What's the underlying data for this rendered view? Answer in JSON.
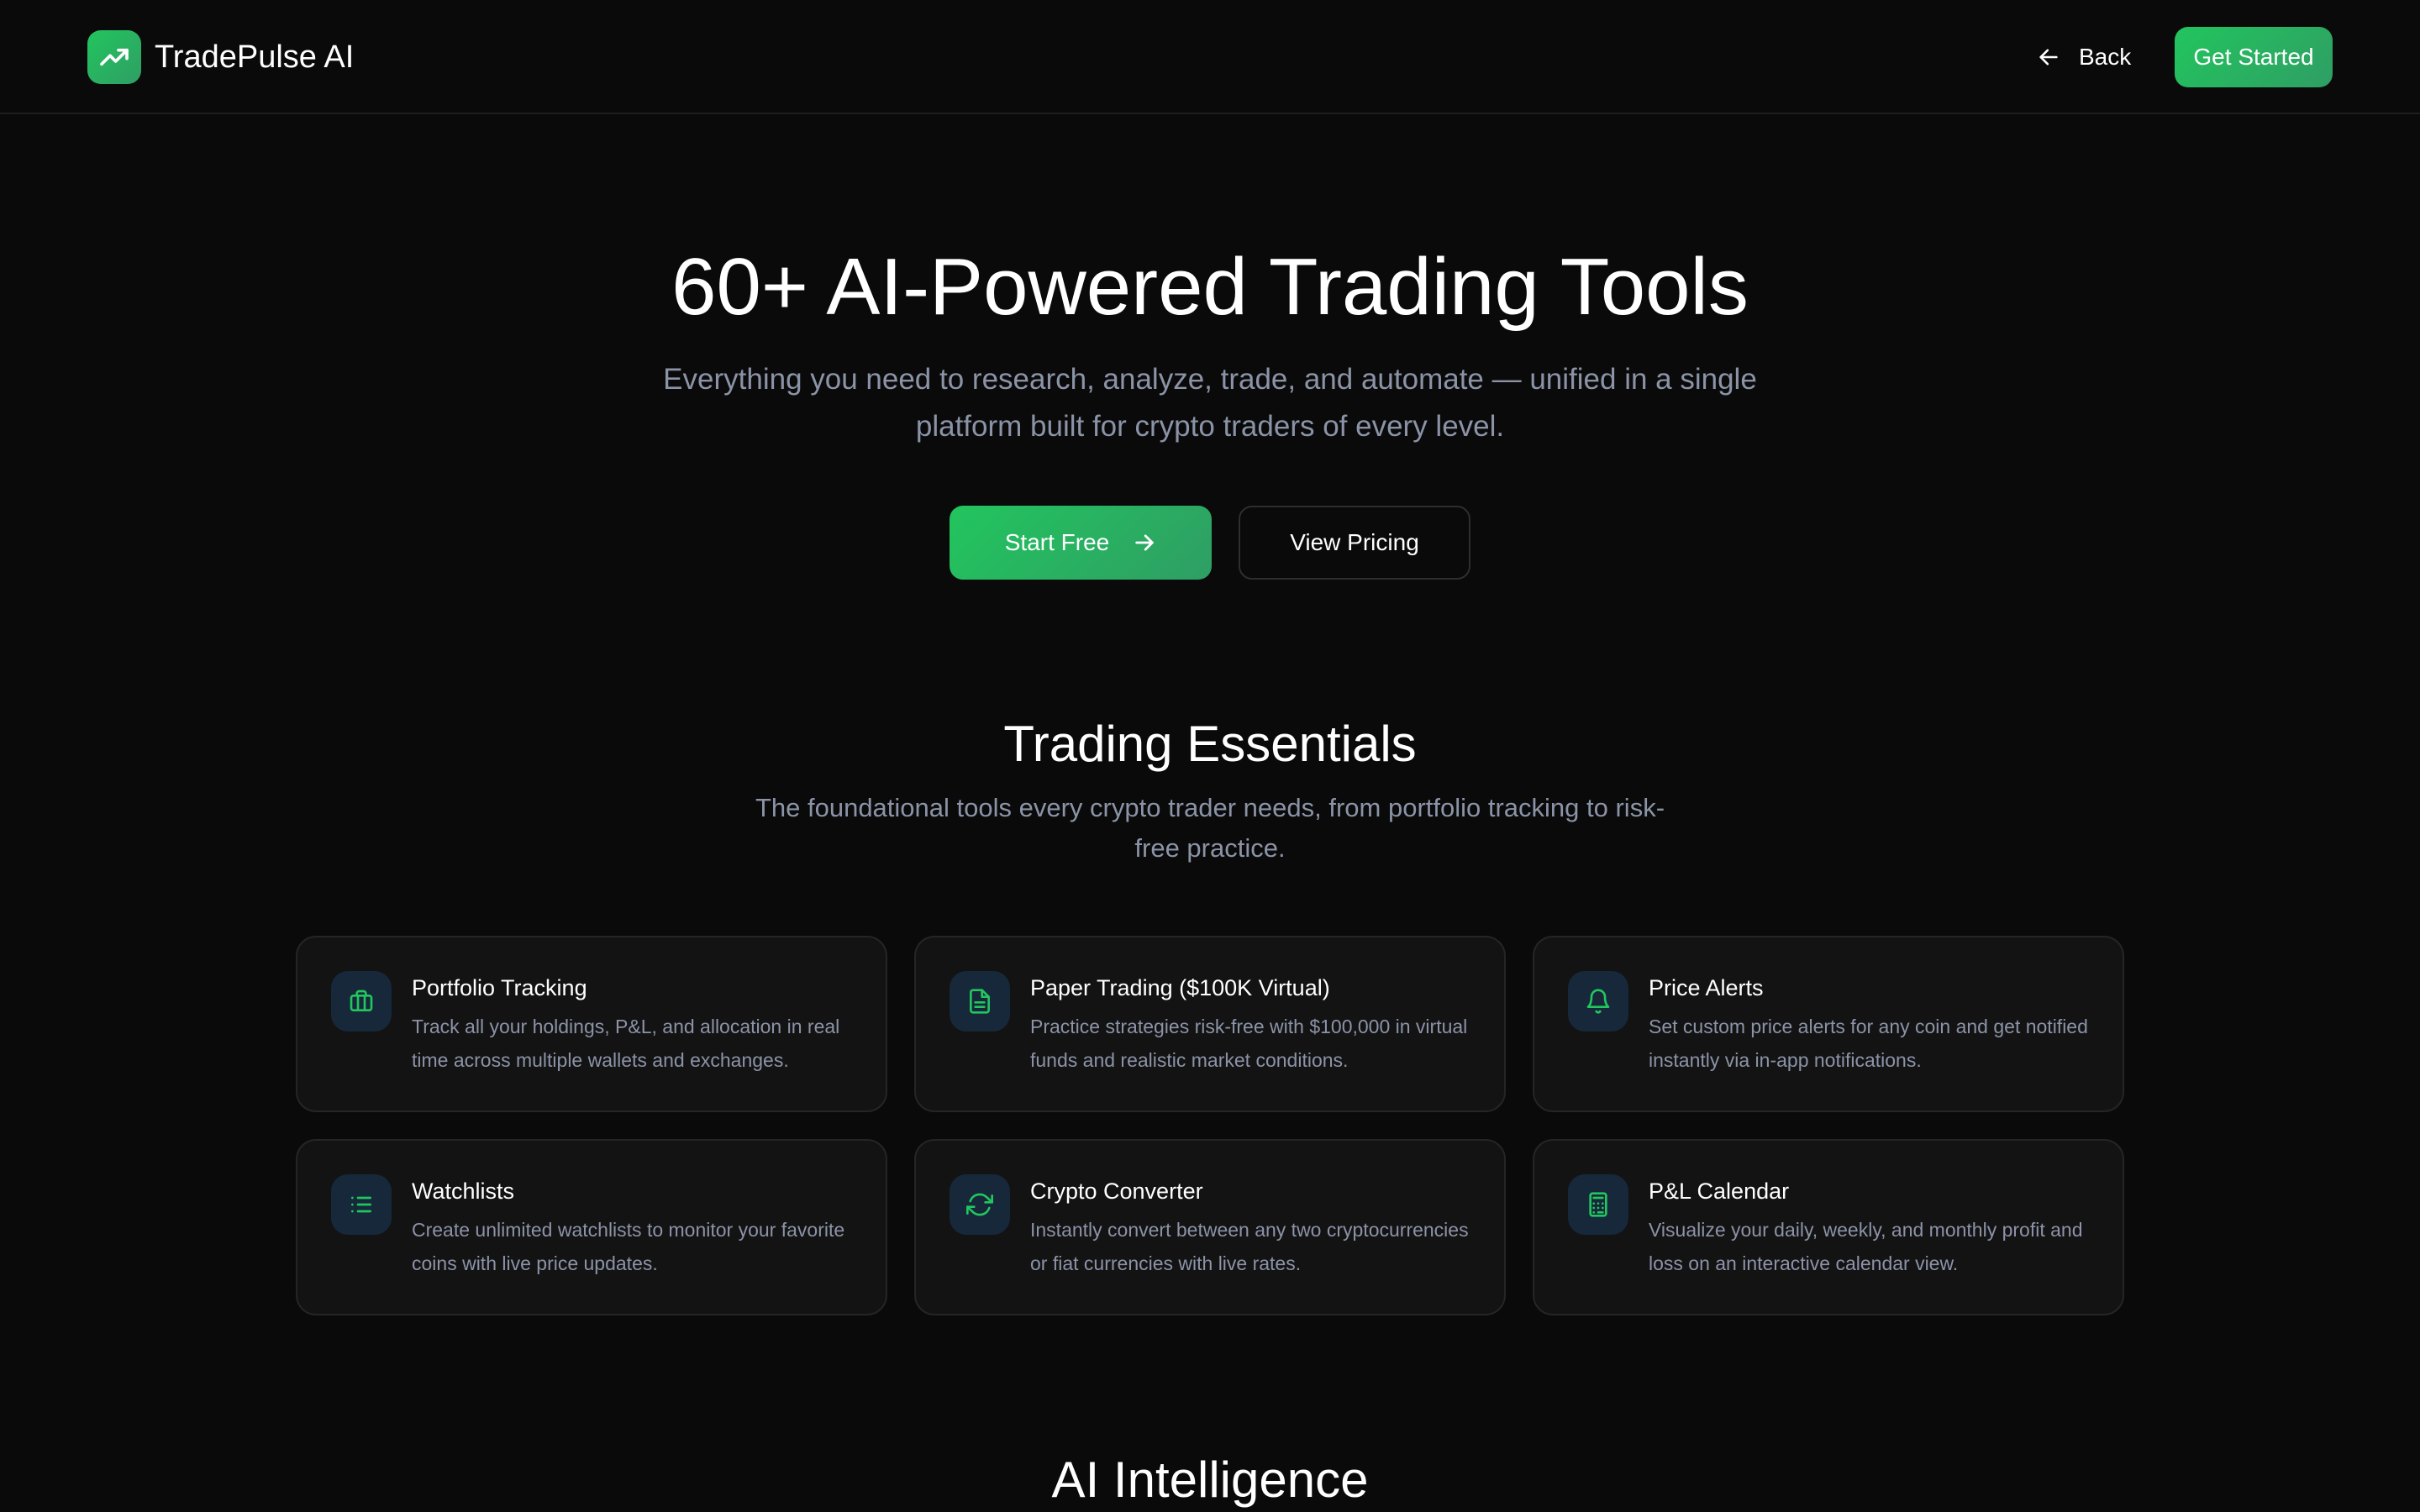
{
  "header": {
    "brand": "TradePulse AI",
    "back_label": "Back",
    "cta_label": "Get Started"
  },
  "hero": {
    "title": "60+ AI-Powered Trading Tools",
    "subtitle": "Everything you need to research, analyze, trade, and automate — unified in a single platform built for crypto traders of every level.",
    "primary_label": "Start Free",
    "secondary_label": "View Pricing"
  },
  "essentials": {
    "title": "Trading Essentials",
    "subtitle": "The foundational tools every crypto trader needs, from portfolio tracking to risk-free practice.",
    "cards": [
      {
        "icon": "briefcase-icon",
        "title": "Portfolio Tracking",
        "desc": "Track all your holdings, P&L, and allocation in real time across multiple wallets and exchanges."
      },
      {
        "icon": "document-icon",
        "title": "Paper Trading ($100K Virtual)",
        "desc": "Practice strategies risk-free with $100,000 in virtual funds and realistic market conditions."
      },
      {
        "icon": "bell-icon",
        "title": "Price Alerts",
        "desc": "Set custom price alerts for any coin and get notified instantly via in-app notifications."
      },
      {
        "icon": "list-icon",
        "title": "Watchlists",
        "desc": "Create unlimited watchlists to monitor your favorite coins with live price updates."
      },
      {
        "icon": "refresh-icon",
        "title": "Crypto Converter",
        "desc": "Instantly convert between any two cryptocurrencies or fiat currencies with live rates."
      },
      {
        "icon": "calculator-icon",
        "title": "P&L Calendar",
        "desc": "Visualize your daily, weekly, and monthly profit and loss on an interactive calendar view."
      }
    ]
  },
  "ai_section": {
    "title": "AI Intelligence"
  },
  "colors": {
    "background": "#0a0a0a",
    "accent": "#22c55e",
    "muted_text": "#8b93a7",
    "card_bg": "#131313",
    "icon_tile_bg": "#16283a"
  }
}
